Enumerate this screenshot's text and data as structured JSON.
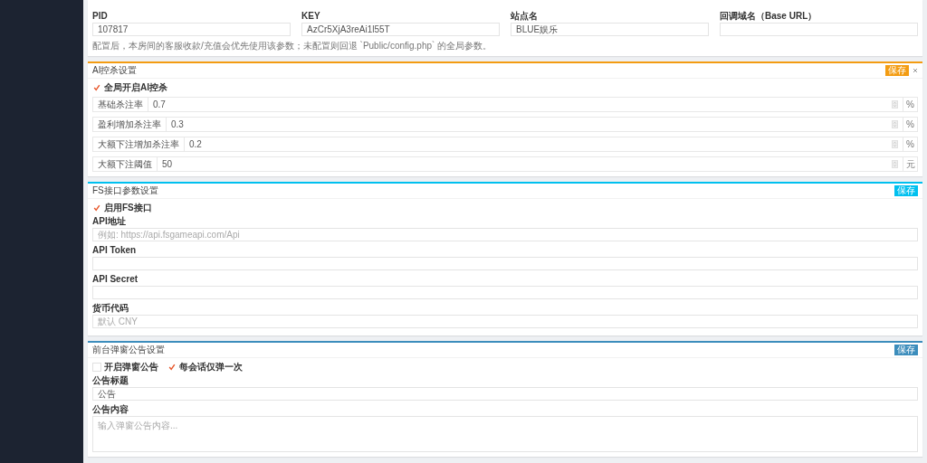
{
  "panels": [
    {
      "kind": "grid",
      "fields": [
        {
          "label": "PID",
          "value": "107817"
        },
        {
          "label": "KEY",
          "value": "AzCr5XjA3reAi1l55T"
        },
        {
          "label": "站点名",
          "value": "BLUE娱乐"
        },
        {
          "label": "回调域名（Base URL）"
        }
      ],
      "note": "配置后，本房间的客服收款/充值会优先使用该参数；未配置则回退 `Public/config.php` 的全局参数。"
    },
    {
      "kind": "rates",
      "color": "#f39c12",
      "title": "AI控杀设置",
      "save_button": "保存",
      "closable": true,
      "checkboxes": [
        {
          "label": "全局开启AI控杀",
          "checked": true
        }
      ],
      "rows": [
        {
          "label": "基础杀注率",
          "value": "0.7",
          "unit": "%"
        },
        {
          "label": "盈利增加杀注率",
          "value": "0.3",
          "unit": "%"
        },
        {
          "label": "大额下注增加杀注率",
          "value": "0.2",
          "unit": "%"
        },
        {
          "label": "大额下注阈值",
          "value": "50",
          "unit": "元"
        }
      ]
    },
    {
      "kind": "form",
      "color": "#00c0ef",
      "title": "FS接口参数设置",
      "save_button": "保存",
      "closable": false,
      "checkboxes": [
        {
          "label": "启用FS接口",
          "checked": true
        }
      ],
      "fields": [
        {
          "kind": "input",
          "label": "API地址",
          "placeholder": "例如: https://api.fsgameapi.com/Api"
        },
        {
          "kind": "input",
          "label": "API Token"
        },
        {
          "kind": "input",
          "label": "API Secret"
        },
        {
          "kind": "input",
          "label": "货币代码",
          "placeholder": "默认 CNY"
        }
      ]
    },
    {
      "kind": "form",
      "color": "#3c8dbc",
      "title": "前台弹窗公告设置",
      "save_button": "保存",
      "closable": false,
      "checkboxes": [
        {
          "label": "开启弹窗公告",
          "checked": false
        },
        {
          "label": "每会话仅弹一次",
          "checked": true
        }
      ],
      "fields": [
        {
          "kind": "input",
          "label": "公告标题",
          "value": "公告"
        },
        {
          "kind": "textarea",
          "label": "公告内容",
          "placeholder": "输入弹窗公告内容..."
        }
      ]
    }
  ]
}
